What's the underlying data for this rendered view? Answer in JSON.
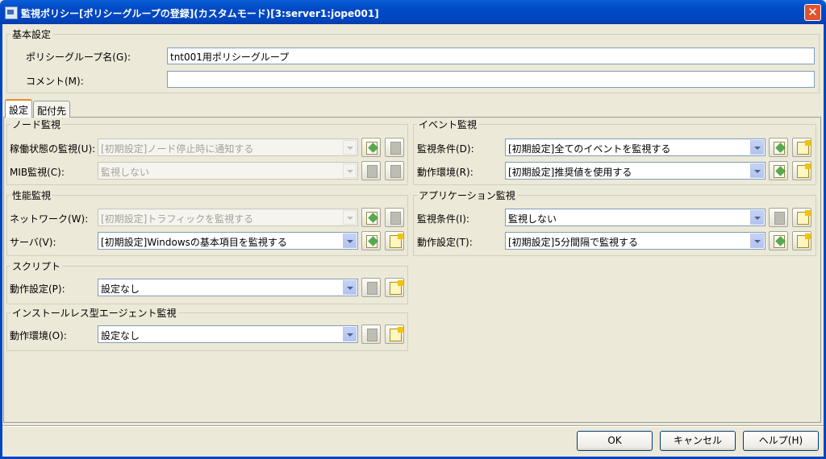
{
  "window": {
    "title": "監視ポリシー[ポリシーグループの登録](カスタムモード)[3:server1:jope001]",
    "close_glyph": "✕"
  },
  "basic": {
    "legend": "基本設定",
    "name_label": "ポリシーグループ名(G):",
    "name_value": "tnt001用ポリシーグループ",
    "comment_label": "コメント(M):",
    "comment_value": ""
  },
  "tabs": [
    "設定",
    "配付先"
  ],
  "node": {
    "legend": "ノード監視",
    "rows": [
      {
        "label": "稼働状態の監視(U):",
        "value": "[初期設定]ノード停止時に通知する",
        "enabled": false
      },
      {
        "label": "MIB監視(C):",
        "value": "監視しない",
        "enabled": false
      }
    ]
  },
  "perf": {
    "legend": "性能監視",
    "rows": [
      {
        "label": "ネットワーク(W):",
        "value": "[初期設定]トラフィックを監視する",
        "enabled": false
      },
      {
        "label": "サーバ(V):",
        "value": "[初期設定]Windowsの基本項目を監視する",
        "enabled": true
      }
    ]
  },
  "script": {
    "legend": "スクリプト",
    "rows": [
      {
        "label": "動作設定(P):",
        "value": "設定なし",
        "enabled": true
      }
    ]
  },
  "agentless": {
    "legend": "インストールレス型エージェント監視",
    "rows": [
      {
        "label": "動作環境(O):",
        "value": "設定なし",
        "enabled": true
      }
    ]
  },
  "event": {
    "legend": "イベント監視",
    "rows": [
      {
        "label": "監視条件(D):",
        "value": "[初期設定]全てのイベントを監視する",
        "enabled": true
      },
      {
        "label": "動作環境(R):",
        "value": "[初期設定]推奨値を使用する",
        "enabled": true
      }
    ]
  },
  "app": {
    "legend": "アプリケーション監視",
    "rows": [
      {
        "label": "監視条件(I):",
        "value": "監視しない",
        "enabled": true
      },
      {
        "label": "動作設定(T):",
        "value": "[初期設定]5分間隔で監視する",
        "enabled": true
      }
    ]
  },
  "buttons": {
    "ok": "OK",
    "cancel": "キャンセル",
    "help": "ヘルプ(H)"
  }
}
